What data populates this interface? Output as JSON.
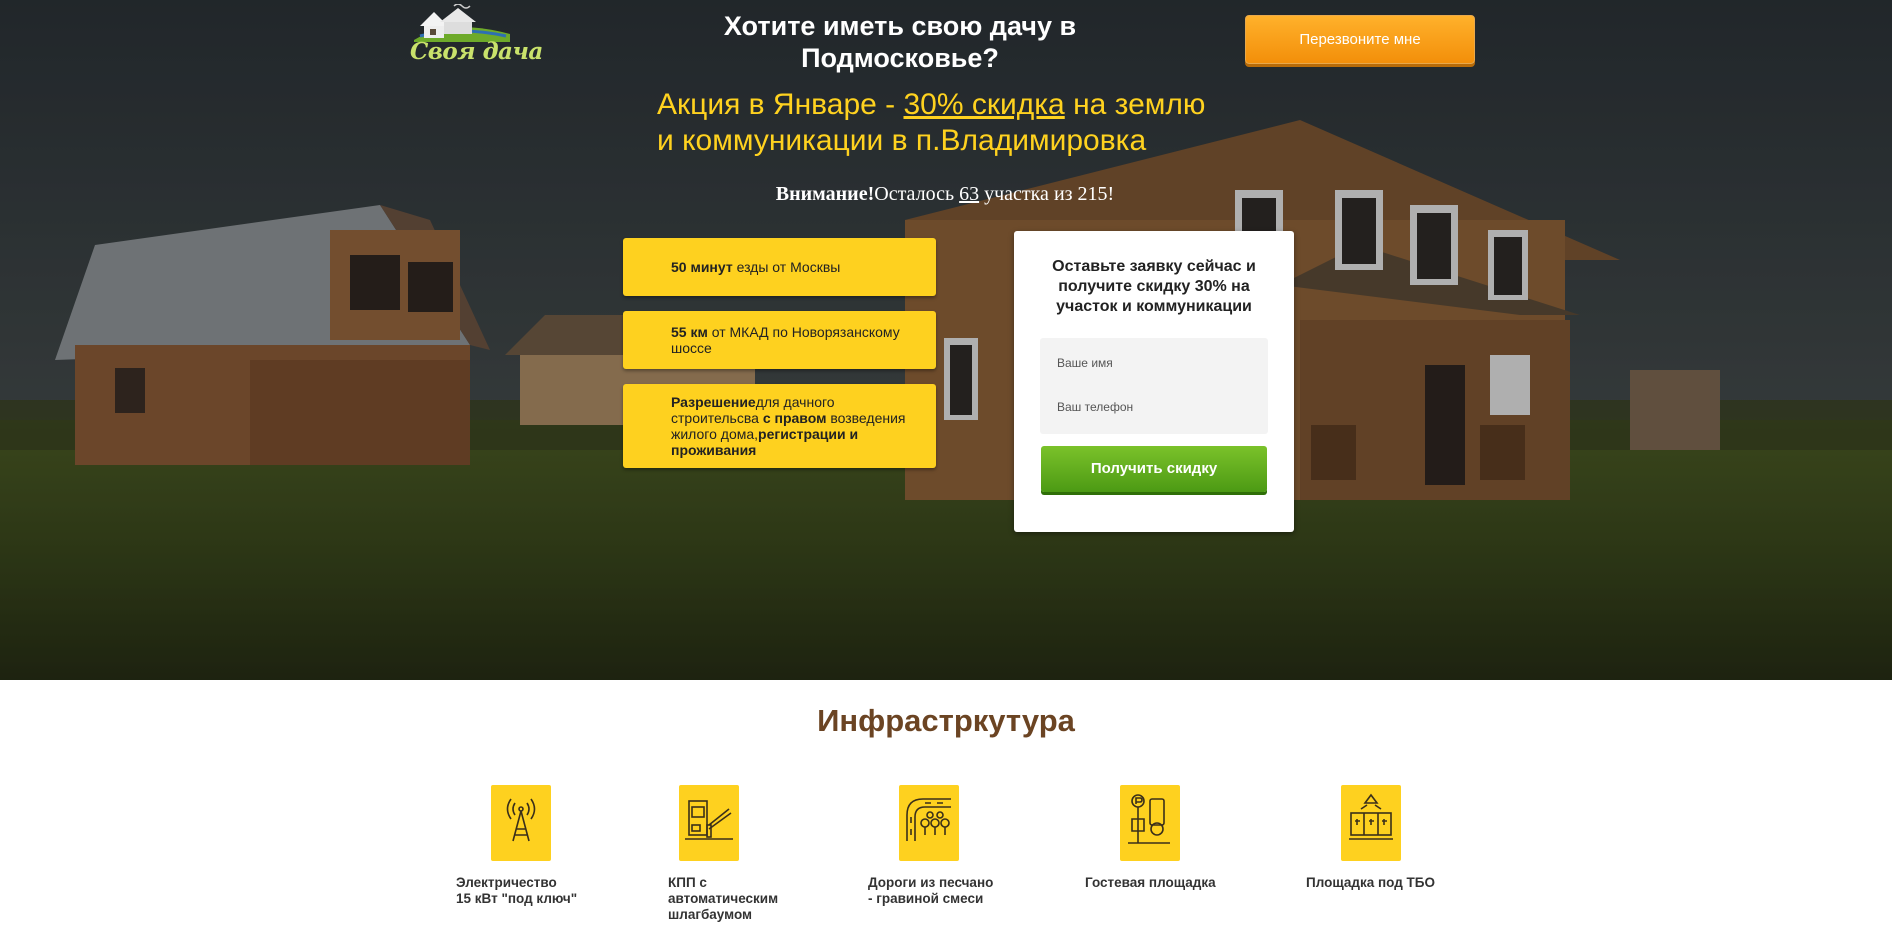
{
  "header": {
    "logo_text": "Своя дача",
    "headline": "Хотите иметь свою дачу в Подмосковье?",
    "call_button_label": "Перезвоните мне"
  },
  "promo": {
    "part1": "Акция в Январе - ",
    "discount": "30% скидка",
    "part2": " на землю",
    "line2": "и коммуникации в п.Владимировка"
  },
  "notice": {
    "attention": "Внимание!",
    "text1": "Осталось ",
    "remaining": "63",
    "text2": " участка из 215!"
  },
  "features": [
    {
      "bold": "50 минут",
      "text": " езды от Москвы"
    },
    {
      "bold": "55 км",
      "text": " от МКАД по Новорязанскому шоссе"
    },
    {
      "bold": "Разрешение",
      "text1": "для дачного строительсва ",
      "bold2": "с правом",
      "text2": " возведения жилого дома,",
      "bold3": "регистрации и проживания"
    }
  ],
  "form": {
    "title": "Оставьте заявку сейчас и получите скидку 30% на участок и коммуникации",
    "name_placeholder": "Ваше имя",
    "phone_placeholder": "Ваш телефон",
    "submit_label": "Получить скидку"
  },
  "infrastructure": {
    "title": "Инфрастркутура",
    "items": [
      {
        "icon": "electricity-tower-icon",
        "line1": "Электричество",
        "line2": "15 кВт \"под ключ\"",
        "line3": ""
      },
      {
        "icon": "checkpoint-barrier-icon",
        "line1": "КПП с",
        "line2": "автоматическим",
        "line3": "шлагбаумом"
      },
      {
        "icon": "road-trees-icon",
        "line1": "Дороги из песчано",
        "line2": "- гравиной смеси",
        "line3": ""
      },
      {
        "icon": "guest-parking-icon",
        "line1": "Гостевая площадка",
        "line2": "",
        "line3": ""
      },
      {
        "icon": "waste-bins-icon",
        "line1": "Площадка под ТБО",
        "line2": "",
        "line3": ""
      }
    ]
  },
  "colors": {
    "accent_yellow": "#fed11f",
    "call_orange": "#f38f0a",
    "submit_green": "#5aa81b",
    "title_brown": "#6b4423"
  }
}
